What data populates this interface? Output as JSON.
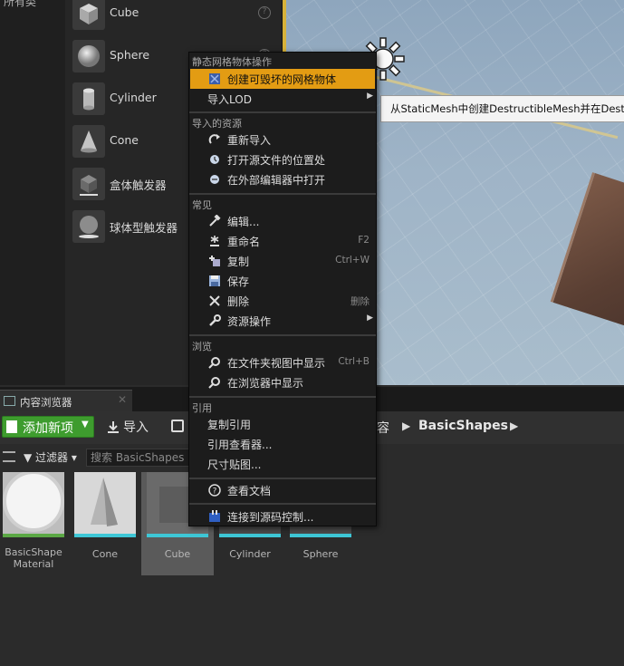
{
  "left_panel": {
    "category_label": "所有类"
  },
  "place_actors": {
    "items": [
      {
        "label": "Cube",
        "icon": "cube-icon"
      },
      {
        "label": "Sphere",
        "icon": "sphere-icon"
      },
      {
        "label": "Cylinder",
        "icon": "cylinder-icon"
      },
      {
        "label": "Cone",
        "icon": "cone-icon"
      },
      {
        "label": "盒体触发器",
        "icon": "box-trigger-icon"
      },
      {
        "label": "球体型触发器",
        "icon": "sphere-trigger-icon"
      }
    ],
    "help_glyph": "?"
  },
  "tooltip": {
    "text": "从StaticMesh中创建DestructibleMesh并在Destructi"
  },
  "context_menu": {
    "sections": {
      "static_mesh": "静态网格物体操作",
      "imported_asset": "导入的资源",
      "common": "常见",
      "explore": "浏览",
      "references": "引用"
    },
    "items": {
      "create_destructible": "创建可毁坏的网格物体",
      "import_lod": "导入LOD",
      "reimport": "重新导入",
      "open_source_location": "打开源文件的位置处",
      "open_external_editor": "在外部编辑器中打开",
      "edit": "编辑...",
      "rename": "重命名",
      "rename_key": "F2",
      "duplicate": "复制",
      "duplicate_key": "Ctrl+W",
      "save": "保存",
      "delete": "删除",
      "delete_key": "删除",
      "asset_actions": "资源操作",
      "show_in_folder": "在文件夹视图中显示",
      "show_in_folder_key": "Ctrl+B",
      "show_in_explorer": "在浏览器中显示",
      "copy_reference": "复制引用",
      "reference_viewer": "引用查看器...",
      "size_map": "尺寸贴图...",
      "view_docs": "查看文档",
      "connect_source_control": "连接到源码控制..."
    },
    "highlight_color": "#e39c13"
  },
  "content_browser": {
    "tab_label": "内容浏览器",
    "tab_close": "✕",
    "add_new_label": "添加新项",
    "import_label": "导入",
    "breadcrumb": {
      "partial": "容",
      "folder": "BasicShapes"
    },
    "filter_label": "过滤器",
    "search_placeholder": "搜索 BasicShapes",
    "assets": [
      {
        "name": "BasicShape\nMaterial"
      },
      {
        "name": "Cone"
      },
      {
        "name": "Cube"
      },
      {
        "name": "Cylinder"
      },
      {
        "name": "Sphere"
      }
    ],
    "add_button_color": "#3e9c2e"
  }
}
